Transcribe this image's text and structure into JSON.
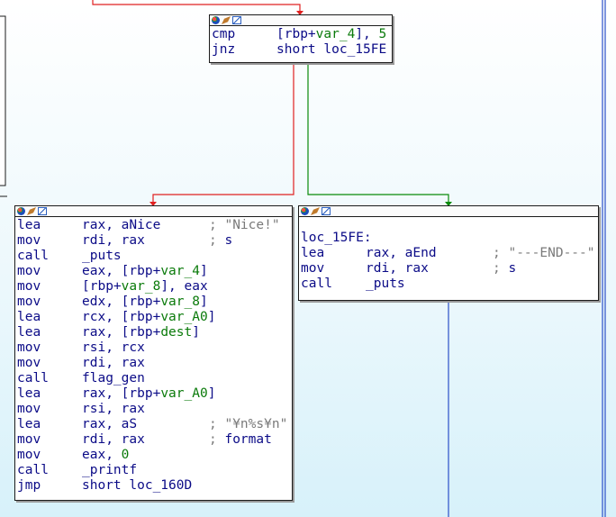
{
  "app": "IDA graph view",
  "colors": {
    "false_edge": "#e02020",
    "true_edge": "#0a8a0a",
    "flow_edge": "#2b4fc8",
    "mnemonic": "#0b0b87",
    "stack_var": "#0a7a0a",
    "comment": "#7a7a7a"
  },
  "blocks": {
    "cond": {
      "icons": [
        "color-palette-icon",
        "rename-icon",
        "graph-overview-icon"
      ],
      "lines": [
        {
          "mn": "cmp",
          "op_pre": "[rbp+",
          "op_var": "var_4",
          "op_post": "], ",
          "op_num": "5"
        },
        {
          "mn": "jnz",
          "op_pre": "short loc_15FE",
          "op_var": "",
          "op_post": "",
          "op_num": ""
        }
      ]
    },
    "nice": {
      "lines": [
        {
          "mn": "lea",
          "op_pre": "rax, aNice",
          "op_var": "",
          "op_post": "",
          "op_num": "",
          "c_sep": ";",
          "c_str": "\"Nice!\"",
          "c_plain": ""
        },
        {
          "mn": "mov",
          "op_pre": "rdi, rax",
          "op_var": "",
          "op_post": "",
          "op_num": "",
          "c_sep": ";",
          "c_str": "",
          "c_plain": "s"
        },
        {
          "mn": "call",
          "op_pre": "_puts",
          "op_var": "",
          "op_post": "",
          "op_num": ""
        },
        {
          "mn": "mov",
          "op_pre": "eax, [rbp+",
          "op_var": "var_4",
          "op_post": "]",
          "op_num": ""
        },
        {
          "mn": "mov",
          "op_pre": "[rbp+",
          "op_var": "var_8",
          "op_post": "], eax",
          "op_num": ""
        },
        {
          "mn": "mov",
          "op_pre": "edx, [rbp+",
          "op_var": "var_8",
          "op_post": "]",
          "op_num": ""
        },
        {
          "mn": "lea",
          "op_pre": "rcx, [rbp+",
          "op_var": "var_A0",
          "op_post": "]",
          "op_num": ""
        },
        {
          "mn": "lea",
          "op_pre": "rax, [rbp+",
          "op_var": "dest",
          "op_post": "]",
          "op_num": ""
        },
        {
          "mn": "mov",
          "op_pre": "rsi, rcx",
          "op_var": "",
          "op_post": "",
          "op_num": ""
        },
        {
          "mn": "mov",
          "op_pre": "rdi, rax",
          "op_var": "",
          "op_post": "",
          "op_num": ""
        },
        {
          "mn": "call",
          "op_pre": "flag_gen",
          "op_var": "",
          "op_post": "",
          "op_num": ""
        },
        {
          "mn": "lea",
          "op_pre": "rax, [rbp+",
          "op_var": "var_A0",
          "op_post": "]",
          "op_num": ""
        },
        {
          "mn": "mov",
          "op_pre": "rsi, rax",
          "op_var": "",
          "op_post": "",
          "op_num": ""
        },
        {
          "mn": "lea",
          "op_pre": "rax, aS",
          "op_var": "",
          "op_post": "",
          "op_num": "",
          "c_sep": ";",
          "c_str": "\"¥n%s¥n\"",
          "c_plain": ""
        },
        {
          "mn": "mov",
          "op_pre": "rdi, rax",
          "op_var": "",
          "op_post": "",
          "op_num": "",
          "c_sep": ";",
          "c_str": "",
          "c_plain": "format"
        },
        {
          "mn": "mov",
          "op_pre": "eax, ",
          "op_var": "",
          "op_post": "",
          "op_num": "0"
        },
        {
          "mn": "call",
          "op_pre": "_printf",
          "op_var": "",
          "op_post": "",
          "op_num": ""
        },
        {
          "mn": "jmp",
          "op_pre": "short loc_160D",
          "op_var": "",
          "op_post": "",
          "op_num": ""
        }
      ]
    },
    "end": {
      "label": "loc_15FE:",
      "lines": [
        {
          "mn": "lea",
          "op_pre": "rax, aEnd",
          "op_var": "",
          "op_post": "",
          "op_num": "",
          "c_sep": ";",
          "c_str": "\"---END---\"",
          "c_plain": ""
        },
        {
          "mn": "mov",
          "op_pre": "rdi, rax",
          "op_var": "",
          "op_post": "",
          "op_num": "",
          "c_sep": ";",
          "c_str": "",
          "c_plain": "s"
        },
        {
          "mn": "call",
          "op_pre": "_puts",
          "op_var": "",
          "op_post": "",
          "op_num": ""
        }
      ]
    }
  }
}
